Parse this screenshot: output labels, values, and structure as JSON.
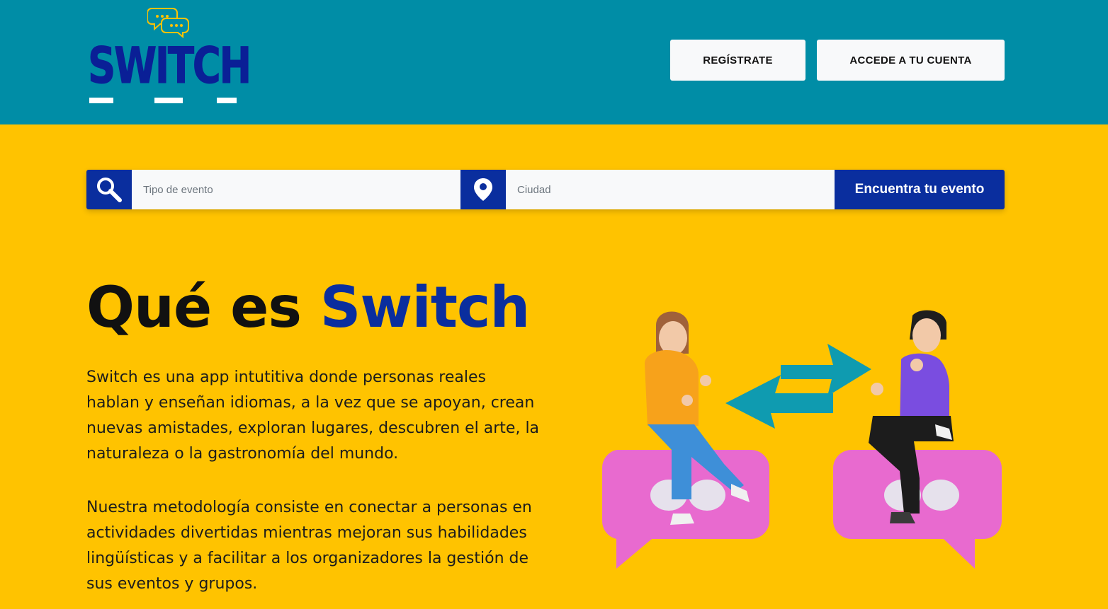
{
  "header": {
    "logo_text": "SWITCH",
    "register_label": "REGÍSTRATE",
    "login_label": "ACCEDE A TU CUENTA"
  },
  "search": {
    "event_type_placeholder": "Tipo de evento",
    "city_placeholder": "Ciudad",
    "submit_label": "Encuentra tu evento",
    "search_icon": "search-icon",
    "location_icon": "location-pin-icon"
  },
  "hero": {
    "title_prefix": "Qué es ",
    "title_brand": "Switch",
    "paragraph_1": "Switch es una app intutitiva donde personas reales hablan y enseñan idiomas, a la vez que se apoyan, crean nuevas amistades, exploran lugares, descubren el arte, la naturaleza o la gastronomía del mundo.",
    "paragraph_2": "Nuestra metodología consiste en conectar a personas en actividades divertidas mientras mejoran sus habilidades lingüísticas y a facilitar a los organizadores la gestión de sus eventos y grupos."
  },
  "colors": {
    "header_bg": "#008DA6",
    "page_bg": "#FFC300",
    "brand_blue": "#0A2E9E",
    "bubble_pink": "#E86ACF",
    "arrow_teal": "#0F9BB0"
  }
}
